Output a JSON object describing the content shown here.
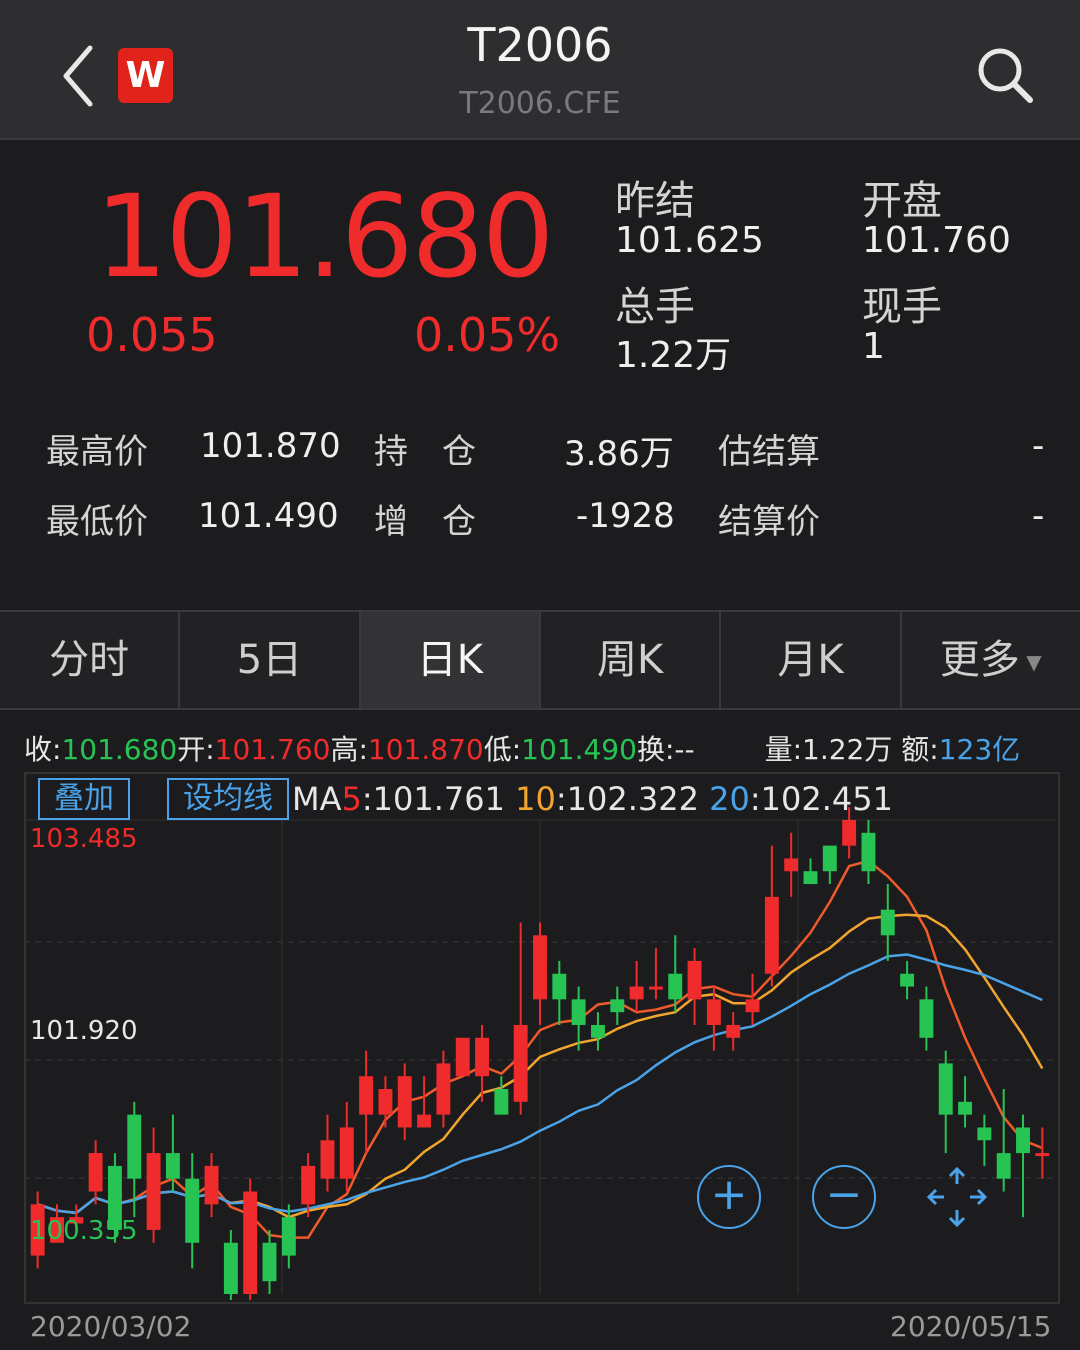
{
  "header": {
    "title": "T2006",
    "subtitle": "T2006.CFE",
    "logo": "W"
  },
  "quote": {
    "price": "101.680",
    "change": "0.055",
    "change_pct": "0.05%",
    "stats": [
      {
        "label": "昨结",
        "value": "101.625"
      },
      {
        "label": "开盘",
        "value": "101.760"
      },
      {
        "label": "总手",
        "value": "1.22万"
      },
      {
        "label": "现手",
        "value": "1"
      }
    ]
  },
  "details": {
    "high_label": "最高价",
    "high": "101.870",
    "low_label": "最低价",
    "low": "101.490",
    "oi_label": "持　仓",
    "oi": "3.86万",
    "oi_chg_label": "增　仓",
    "oi_chg": "-1928",
    "est_label": "估结算",
    "est": "-",
    "settle_label": "结算价",
    "settle": "-"
  },
  "tabs": [
    "分时",
    "5日",
    "日K",
    "周K",
    "月K",
    "更多"
  ],
  "infoline": {
    "close_label": "收:",
    "close": "101.680",
    "open_label": "开:",
    "open": "101.760",
    "high_label": "高:",
    "high": "101.870",
    "low_label": "低:",
    "low": "101.490",
    "turn_label": "换:",
    "turn": "--",
    "vol_label": "量:",
    "vol": "1.22万",
    "amt_label": "额:",
    "amt": "123亿"
  },
  "chart_controls": {
    "overlay": "叠加",
    "ma_set": "设均线",
    "ma_text_prefix": "MA",
    "ma5_key": "5",
    "ma5": ":101.761",
    "ma10_key": "10",
    "ma10": ":102.322",
    "ma20_key": "20",
    "ma20": ":102.451"
  },
  "colors": {
    "up": "#ef2b2b",
    "down": "#27c454",
    "ma5": "#ef5a2b",
    "ma10": "#f2a52e",
    "ma20": "#4aa3e8"
  },
  "icons": [
    "back-chevron-icon",
    "search-icon",
    "zoom-in-icon",
    "zoom-out-icon",
    "move-icon"
  ],
  "chart_data": {
    "type": "candlestick",
    "y_labels": [
      "103.485",
      "101.920",
      "100.355"
    ],
    "start_date": "2020/03/02",
    "end_date": "2020/05/15",
    "ylim": [
      99.9,
      103.6
    ],
    "candles": [
      [
        100.2,
        100.6,
        100.1,
        100.7
      ],
      [
        100.3,
        100.5,
        100.3,
        100.6
      ],
      [
        100.45,
        100.5,
        100.4,
        100.6
      ],
      [
        100.7,
        101.0,
        100.6,
        101.1
      ],
      [
        100.9,
        100.4,
        100.3,
        101.0
      ],
      [
        101.3,
        100.8,
        100.5,
        101.4
      ],
      [
        100.4,
        101.0,
        100.3,
        101.2
      ],
      [
        101.0,
        100.8,
        100.7,
        101.3
      ],
      [
        100.8,
        100.3,
        100.1,
        101.0
      ],
      [
        100.6,
        100.9,
        100.5,
        101.0
      ],
      [
        100.3,
        99.9,
        99.7,
        100.4
      ],
      [
        99.9,
        100.7,
        99.7,
        100.8
      ],
      [
        100.3,
        100.0,
        99.9,
        100.4
      ],
      [
        100.5,
        100.2,
        100.1,
        100.6
      ],
      [
        100.6,
        100.9,
        100.5,
        101.0
      ],
      [
        100.8,
        101.1,
        100.7,
        101.3
      ],
      [
        100.8,
        101.2,
        100.7,
        101.4
      ],
      [
        101.3,
        101.6,
        101.0,
        101.8
      ],
      [
        101.3,
        101.5,
        101.2,
        101.6
      ],
      [
        101.2,
        101.6,
        101.1,
        101.7
      ],
      [
        101.2,
        101.3,
        101.2,
        101.6
      ],
      [
        101.3,
        101.7,
        101.2,
        101.8
      ],
      [
        101.6,
        101.9,
        101.6,
        101.9
      ],
      [
        101.6,
        101.9,
        101.4,
        102.0
      ],
      [
        101.5,
        101.3,
        101.3,
        101.6
      ],
      [
        101.4,
        102.0,
        101.3,
        102.8
      ],
      [
        102.2,
        102.7,
        102.0,
        102.8
      ],
      [
        102.4,
        102.2,
        102.0,
        102.5
      ],
      [
        102.2,
        102.0,
        101.8,
        102.3
      ],
      [
        102.0,
        101.9,
        101.8,
        102.1
      ],
      [
        102.2,
        102.1,
        102.0,
        102.3
      ],
      [
        102.2,
        102.3,
        102.1,
        102.5
      ],
      [
        102.3,
        102.3,
        102.2,
        102.6
      ],
      [
        102.4,
        102.2,
        102.1,
        102.7
      ],
      [
        102.2,
        102.5,
        102.0,
        102.6
      ],
      [
        102.0,
        102.2,
        101.8,
        102.3
      ],
      [
        101.9,
        102.0,
        101.8,
        102.1
      ],
      [
        102.1,
        102.2,
        102.0,
        102.4
      ],
      [
        102.4,
        103.0,
        102.3,
        103.4
      ],
      [
        103.2,
        103.3,
        103.0,
        103.5
      ],
      [
        103.2,
        103.1,
        103.1,
        103.3
      ],
      [
        103.4,
        103.2,
        103.1,
        103.4
      ],
      [
        103.4,
        103.6,
        103.3,
        103.7
      ],
      [
        103.5,
        103.2,
        103.1,
        103.6
      ],
      [
        102.9,
        102.7,
        102.5,
        103.1
      ],
      [
        102.4,
        102.3,
        102.2,
        102.5
      ],
      [
        102.2,
        101.9,
        101.8,
        102.3
      ],
      [
        101.7,
        101.3,
        101.0,
        101.8
      ],
      [
        101.4,
        101.3,
        101.2,
        101.6
      ],
      [
        101.2,
        101.1,
        100.9,
        101.3
      ],
      [
        101.0,
        100.8,
        100.7,
        101.5
      ],
      [
        101.2,
        101.0,
        100.5,
        101.3
      ],
      [
        101.0,
        101.0,
        100.8,
        101.2
      ]
    ]
  }
}
